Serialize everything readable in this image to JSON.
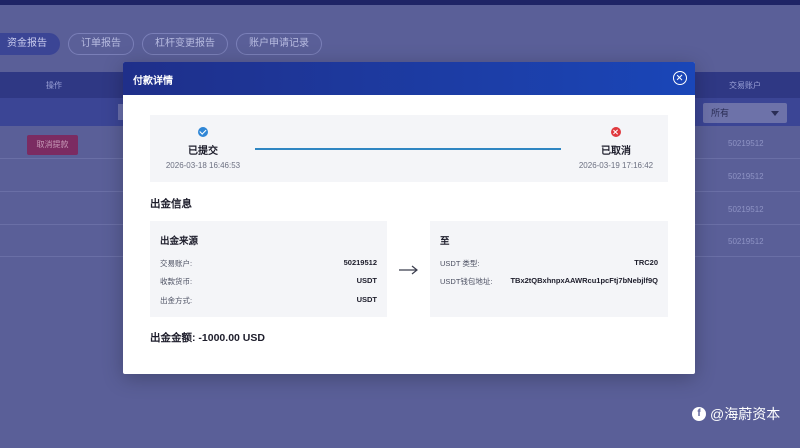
{
  "background": {
    "tabs": [
      {
        "label": "资金报告"
      },
      {
        "label": "订单报告"
      },
      {
        "label": "杠杆变更报告"
      },
      {
        "label": "账户申请记录"
      }
    ],
    "table": {
      "col_operation": "操作",
      "col_account": "交易账户",
      "filter_select": "所有",
      "cancel_withdraw_label": "取消提款",
      "rows": [
        {
          "account": "50219512"
        },
        {
          "account": "50219512"
        },
        {
          "account": "50219512"
        },
        {
          "account": "50219512"
        }
      ]
    }
  },
  "modal": {
    "title": "付款详情",
    "timeline": {
      "submitted": {
        "label": "已提交",
        "time": "2026-03-18 16:46:53"
      },
      "cancelled": {
        "label": "已取消",
        "time": "2026-03-19 17:16:42"
      }
    },
    "section_title": "出金信息",
    "source": {
      "title": "出金来源",
      "rows": [
        {
          "key": "交易账户:",
          "value": "50219512"
        },
        {
          "key": "收款货币:",
          "value": "USDT"
        },
        {
          "key": "出金方式:",
          "value": "USDT"
        }
      ]
    },
    "destination": {
      "title": "至",
      "rows": [
        {
          "key": "USDT 类型:",
          "value": "TRC20"
        },
        {
          "key": "USDT钱包地址:",
          "value": "TBx2tQBxhnpxAAWRcu1pcFtj7bNebjlf9Q"
        }
      ]
    },
    "amount": {
      "label": "出金金额:",
      "value": "-1000.00 USD"
    }
  },
  "watermark": {
    "text": "@海蔚资本"
  },
  "colors": {
    "header_start": "#1f2f8a",
    "header_end": "#1a46b8",
    "timeline_line": "#2f86c2",
    "success": "#2f86d6",
    "error": "#e0393e"
  }
}
